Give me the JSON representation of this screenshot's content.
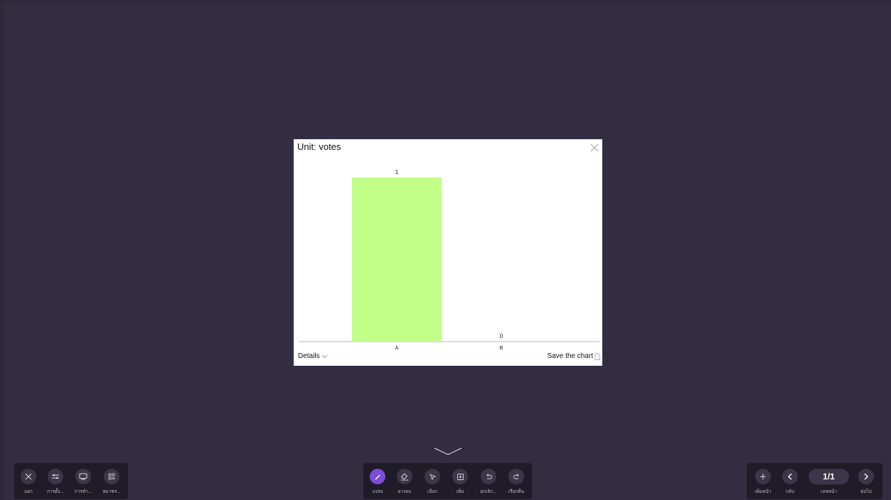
{
  "modal": {
    "title": "Unit: votes",
    "details_label": "Details",
    "save_label": "Save the chart"
  },
  "chart_data": {
    "type": "bar",
    "categories": [
      "A",
      "B"
    ],
    "values": [
      1,
      0
    ],
    "title": "",
    "ylabel": "Unit: votes",
    "ylim": [
      0,
      1
    ],
    "bar_color": "#c1fe87",
    "show_data_labels": true,
    "grid": false,
    "legend": "none"
  },
  "toolbar_left": {
    "items": [
      {
        "icon": "close-icon",
        "label": "ออก"
      },
      {
        "icon": "settings-sliders-icon",
        "label": "การตั้ง..."
      },
      {
        "icon": "screen-icon",
        "label": "การทำ..."
      },
      {
        "icon": "apps-grid-icon",
        "label": "สมาชร..."
      }
    ]
  },
  "toolbar_center": {
    "items": [
      {
        "icon": "pen-icon",
        "label": "แปรง"
      },
      {
        "icon": "eraser-icon",
        "label": "ยางลบ"
      },
      {
        "icon": "select-icon",
        "label": "เลือก"
      },
      {
        "icon": "add-note-icon",
        "label": "เพิ่ม"
      },
      {
        "icon": "undo-icon",
        "label": "ยกเลิก..."
      },
      {
        "icon": "redo-icon",
        "label": "เรียกคืน"
      }
    ],
    "active_color": "#7c4dd6"
  },
  "toolbar_right": {
    "add_label": "เพิ่มหน้า",
    "back_label": "กลับ",
    "page_number": "1/1",
    "page_label": "เลขหน้า",
    "next_label": "ต่อไป"
  }
}
